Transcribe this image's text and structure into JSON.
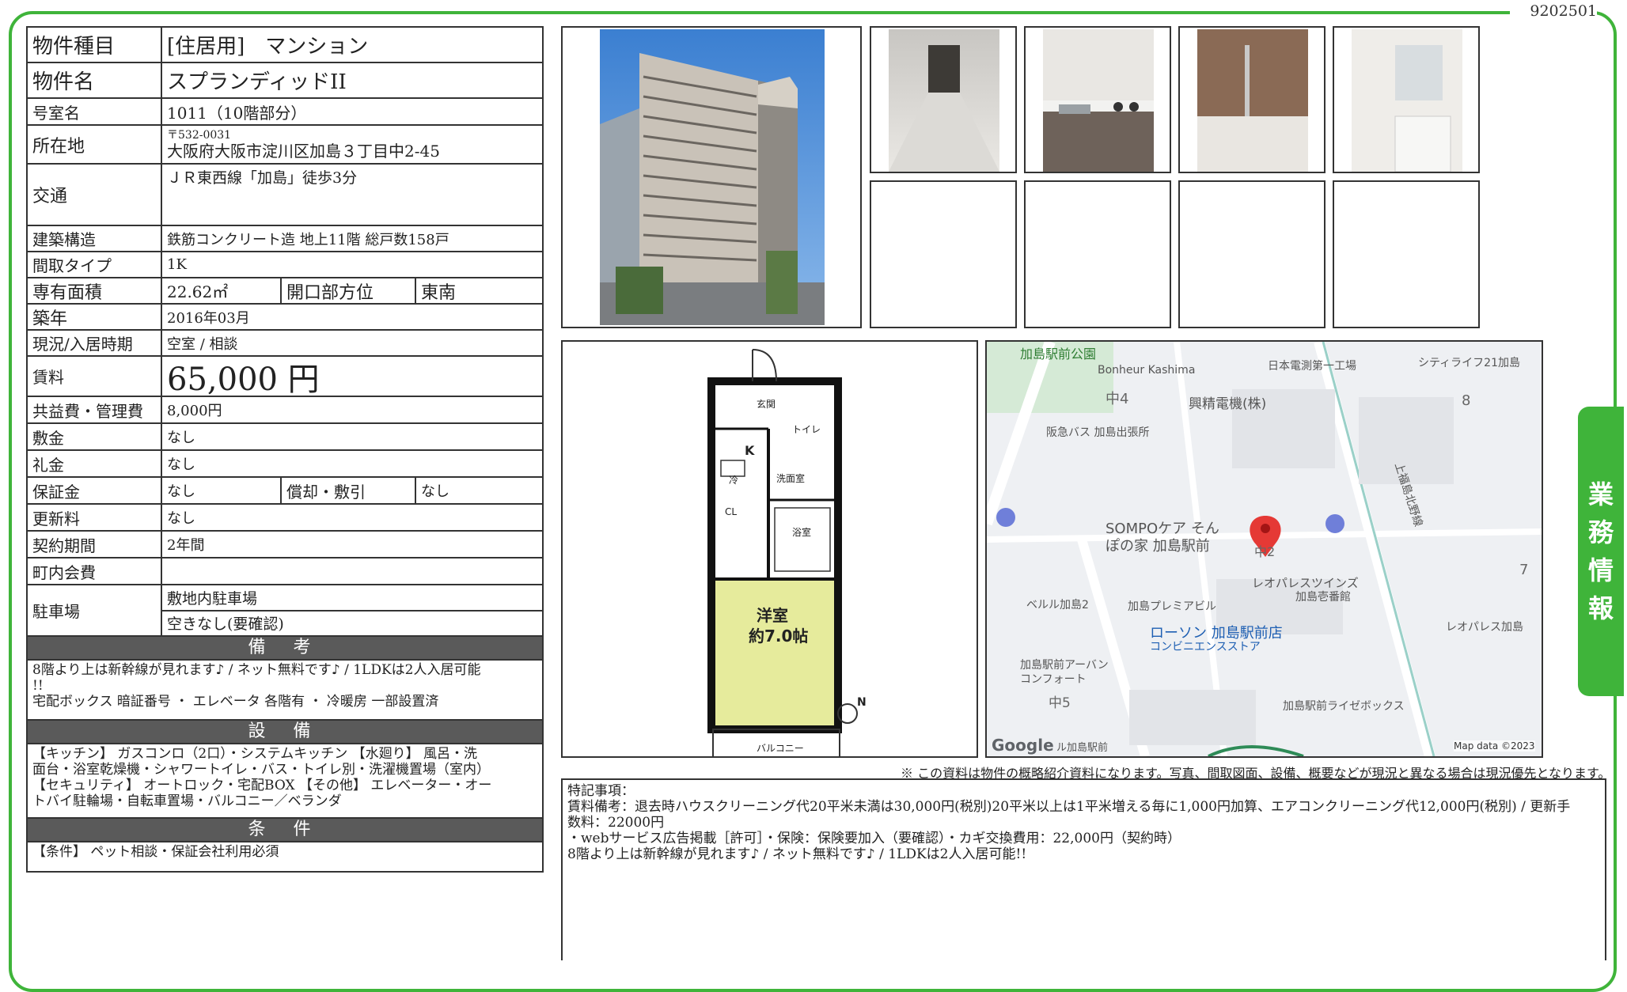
{
  "doc_number": "9202501",
  "side_tab": [
    "業",
    "務",
    "情",
    "報"
  ],
  "property": {
    "type": {
      "label": "物件種目",
      "value": "[住居用]　マンション"
    },
    "name": {
      "label": "物件名",
      "value": "スプランディッドII"
    },
    "room": {
      "label": "号室名",
      "value": "1011（10階部分）"
    },
    "address": {
      "label": "所在地",
      "postal": "〒532-0031",
      "value": "大阪府大阪市淀川区加島３丁目中2-45"
    },
    "access": {
      "label": "交通",
      "value": "ＪＲ東西線「加島」徒歩3分"
    },
    "structure": {
      "label": "建築構造",
      "value": "鉄筋コンクリート造 地上11階 総戸数158戸"
    },
    "layout": {
      "label": "間取タイプ",
      "value": "1K"
    },
    "area": {
      "label": "専有面積",
      "value": "22.62㎡",
      "label2": "開口部方位",
      "value2": "東南"
    },
    "built": {
      "label": "築年",
      "value": "2016年03月"
    },
    "status": {
      "label": "現況/入居時期",
      "value": "空室 /  相談"
    },
    "rent": {
      "label": "賃料",
      "value": "65,000 円"
    },
    "fee": {
      "label": "共益費・管理費",
      "value": "8,000円"
    },
    "deposit": {
      "label": "敷金",
      "value": "なし"
    },
    "key_money": {
      "label": "礼金",
      "value": "なし"
    },
    "guarantee": {
      "label": "保証金",
      "value": "なし",
      "label2": "償却・敷引",
      "value2": "なし"
    },
    "renewal": {
      "label": "更新料",
      "value": "なし"
    },
    "contract": {
      "label": "契約期間",
      "value": "2年間"
    },
    "association": {
      "label": "町内会費",
      "value": ""
    },
    "parking": {
      "label": "駐車場",
      "value": "敷地内駐車場",
      "value2": "空きなし(要確認)"
    }
  },
  "notes_section": {
    "title": "備 考",
    "lines": [
      "8階より上は新幹線が見れます♪ / ネット無料です♪ / 1LDKは2人入居可能",
      "!!",
      "宅配ボックス 暗証番号 ・ エレベータ 各階有 ・ 冷暖房 一部設置済"
    ]
  },
  "equipment_section": {
    "title": "設 備",
    "lines": [
      "【キッチン】 ガスコンロ（2口）・システムキッチン 【水廻り】 風呂・洗",
      "面台・浴室乾燥機・シャワートイレ・バス・トイレ別・洗濯機置場（室内）",
      "【セキュリティ】 オートロック・宅配BOX 【その他】 エレベーター・オー",
      "トバイ駐輪場・自転車置場・バルコニー／ベランダ"
    ]
  },
  "conditions_section": {
    "title": "条 件",
    "lines": [
      "【条件】 ペット相談・保証会社利用必須"
    ]
  },
  "floorplan": {
    "room_label": "洋室",
    "room_size": "約7.0帖",
    "k_label": "K",
    "balcony": "バルコニー",
    "entrance": "玄関",
    "toilet": "トイレ",
    "washroom": "洗面室",
    "bath": "浴室",
    "cl": "CL",
    "fridge": "冷",
    "north": "N"
  },
  "map": {
    "labels": [
      "加島駅前公園",
      "Bonheur Kashima",
      "日本電測第一工場",
      "シティライフ21加島",
      "中4",
      "興精電機(株)",
      "阪急バス 加島出張所",
      "8",
      "SOMPOケア そん",
      "ぽの家 加島駅前",
      "中2",
      "レオパレスツインズ",
      "加島壱番館",
      "7",
      "ベルル加島2",
      "加島プレミアビル",
      "ローソン 加島駅前店",
      "コンビニエンスストア",
      "レオパレス加島",
      "加島駅前アーバン",
      "コンフォート",
      "中5",
      "加島駅前ライゼボックス",
      "ル加島駅前",
      "上福島北野線"
    ],
    "google": "Google",
    "copyright": "Map data ©2023"
  },
  "disclaimer": "※ この資料は物件の概略紹介資料になります。写真、間取図面、設備、概要などが現況と異なる場合は現況優先となります。",
  "remarks": {
    "lines": [
      "特記事項：",
      "賃料備考：退去時ハウスクリーニング代20平米未満は30,000円(税別)20平米以上は1平米増える毎に1,000円加算、エアコンクリーニング代12,000円(税別) / 更新手",
      "数料：22000円",
      "・webサービス広告掲載［許可］・保険：保険要加入（要確認）・カギ交換費用：22,000円（契約時）",
      "8階より上は新幹線が見れます♪ / ネット無料です♪ / 1LDKは2人入居可能!!"
    ]
  },
  "colors": {
    "frame": "#3fb43a",
    "section_header": "#5a5a5a",
    "floor_room": "#e6eb9c",
    "map_pin": "#e53935"
  }
}
